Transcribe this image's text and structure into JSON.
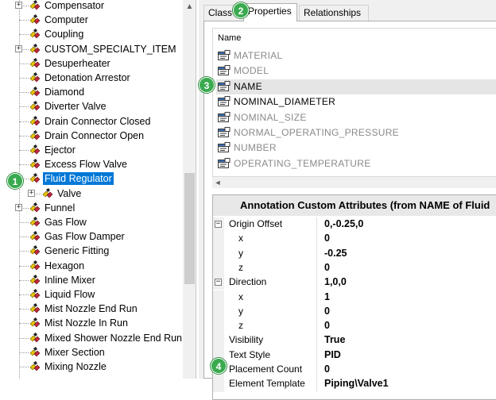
{
  "tree": {
    "items": [
      {
        "label": "Compensator",
        "expander": "+"
      },
      {
        "label": "Computer",
        "expander": ""
      },
      {
        "label": "Coupling",
        "expander": ""
      },
      {
        "label": "CUSTOM_SPECIALTY_ITEM",
        "expander": "+"
      },
      {
        "label": "Desuperheater",
        "expander": ""
      },
      {
        "label": "Detonation Arrestor",
        "expander": ""
      },
      {
        "label": "Diamond",
        "expander": ""
      },
      {
        "label": "Diverter Valve",
        "expander": ""
      },
      {
        "label": "Drain Connector Closed",
        "expander": ""
      },
      {
        "label": "Drain Connector Open",
        "expander": ""
      },
      {
        "label": "Ejector",
        "expander": ""
      },
      {
        "label": "Excess Flow Valve",
        "expander": ""
      },
      {
        "label": "Fluid Regulator",
        "expander": "",
        "selected": true
      },
      {
        "label": "Valve",
        "expander": "+",
        "child": true
      },
      {
        "label": "Funnel",
        "expander": "+"
      },
      {
        "label": "Gas Flow",
        "expander": ""
      },
      {
        "label": "Gas Flow Damper",
        "expander": ""
      },
      {
        "label": "Generic Fitting",
        "expander": ""
      },
      {
        "label": "Hexagon",
        "expander": ""
      },
      {
        "label": "Inline Mixer",
        "expander": ""
      },
      {
        "label": "Liquid Flow",
        "expander": ""
      },
      {
        "label": "Mist Nozzle End Run",
        "expander": ""
      },
      {
        "label": "Mist Nozzle In Run",
        "expander": ""
      },
      {
        "label": "Mixed Shower Nozzle End Run",
        "expander": ""
      },
      {
        "label": "Mixer Section",
        "expander": ""
      },
      {
        "label": "Mixing Nozzle",
        "expander": ""
      }
    ]
  },
  "tabs": [
    {
      "label": "Class",
      "active": false
    },
    {
      "label": "Properties",
      "active": true
    },
    {
      "label": "Relationships",
      "active": false
    }
  ],
  "properties": {
    "column_header": "Name",
    "rows": [
      {
        "name": "MATERIAL",
        "enabled": false
      },
      {
        "name": "MODEL",
        "enabled": false
      },
      {
        "name": "NAME",
        "enabled": true,
        "selected": true
      },
      {
        "name": "NOMINAL_DIAMETER",
        "enabled": true
      },
      {
        "name": "NOMINAL_SIZE",
        "enabled": false
      },
      {
        "name": "NORMAL_OPERATING_PRESSURE",
        "enabled": false
      },
      {
        "name": "NUMBER",
        "enabled": false
      },
      {
        "name": "OPERATING_TEMPERATURE",
        "enabled": false
      }
    ]
  },
  "attributes": {
    "title": "Annotation Custom Attributes (from NAME of Fluid",
    "rows": [
      {
        "name": "Origin Offset",
        "value": "0,-0.25,0",
        "expander": "−",
        "indent": 0
      },
      {
        "name": "x",
        "value": "0",
        "expander": "",
        "indent": 1
      },
      {
        "name": "y",
        "value": "-0.25",
        "expander": "",
        "indent": 1
      },
      {
        "name": "z",
        "value": "0",
        "expander": "",
        "indent": 1
      },
      {
        "name": "Direction",
        "value": "1,0,0",
        "expander": "−",
        "indent": 0
      },
      {
        "name": "x",
        "value": "1",
        "expander": "",
        "indent": 1
      },
      {
        "name": "y",
        "value": "0",
        "expander": "",
        "indent": 1
      },
      {
        "name": "z",
        "value": "0",
        "expander": "",
        "indent": 1
      },
      {
        "name": "Visibility",
        "value": "True",
        "expander": "",
        "indent": 0
      },
      {
        "name": "Text Style",
        "value": "PID",
        "expander": "",
        "indent": 0
      },
      {
        "name": "Placement Count",
        "value": "0",
        "expander": "",
        "indent": 0
      },
      {
        "name": "Element Template",
        "value": "Piping\\Valve1",
        "expander": "",
        "indent": 0
      }
    ]
  },
  "callouts": [
    "1",
    "2",
    "3",
    "4"
  ],
  "colors": {
    "accent": "#0078d7",
    "callout": "#3aaa4f"
  },
  "icons": {
    "tree_node": "class-node-icon",
    "property": "property-icon",
    "scroll_up": "scroll-up-arrow",
    "scroll_left": "scroll-left-arrow"
  },
  "scroll_glyphs": {
    "up": "▲",
    "left": "◄"
  }
}
